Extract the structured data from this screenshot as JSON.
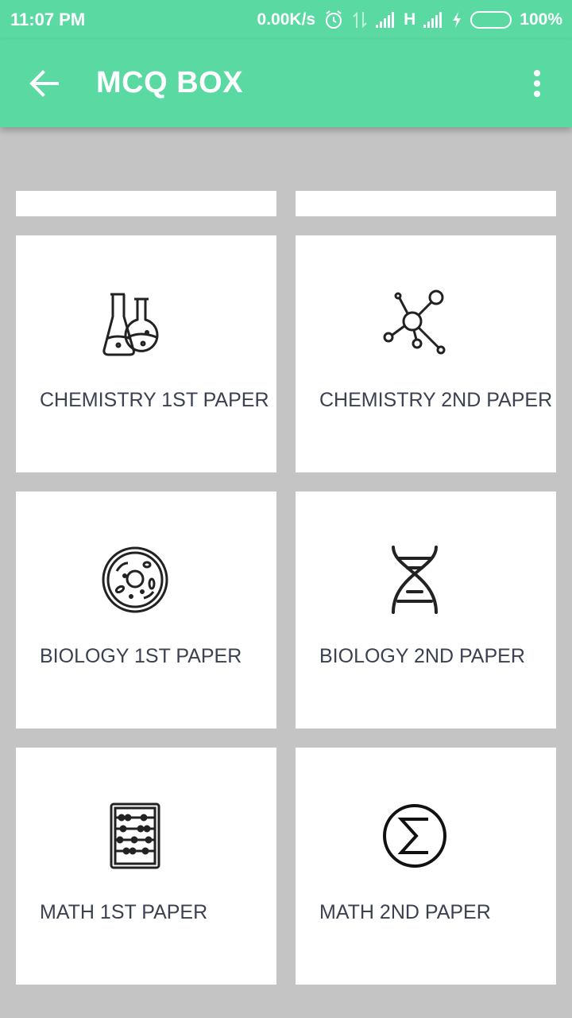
{
  "status": {
    "time": "11:07 PM",
    "speed": "0.00K/s",
    "network": "H",
    "battery": "100%"
  },
  "appbar": {
    "title": "MCQ BOX",
    "back_icon": "arrow-left-icon",
    "menu_icon": "more-vert-icon"
  },
  "colors": {
    "primary": "#5bd9a3",
    "background": "#c4c4c4",
    "card": "#ffffff",
    "text": "#3b4150",
    "battery": "#3cc43a"
  },
  "cards": [
    {
      "label": "CHEMISTRY 1ST PAPER",
      "icon": "flasks-icon"
    },
    {
      "label": "CHEMISTRY 2ND PAPER",
      "icon": "molecule-icon"
    },
    {
      "label": "BIOLOGY 1ST PAPER",
      "icon": "cell-icon"
    },
    {
      "label": "BIOLOGY 2ND PAPER",
      "icon": "dna-icon"
    },
    {
      "label": "MATH 1ST PAPER",
      "icon": "abacus-icon"
    },
    {
      "label": "MATH 2ND PAPER",
      "icon": "sigma-icon"
    }
  ]
}
